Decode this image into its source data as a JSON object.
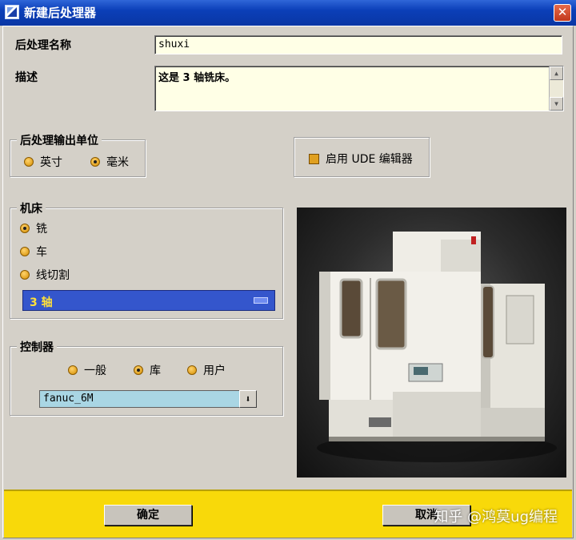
{
  "window": {
    "title": "新建后处理器",
    "close_glyph": "✕"
  },
  "fields": {
    "name_label": "后处理名称",
    "name_value": "shuxi",
    "desc_label": "描述",
    "desc_value": "这是 3 轴铣床。"
  },
  "units": {
    "title": "后处理输出单位",
    "options": [
      {
        "label": "英寸",
        "selected": false
      },
      {
        "label": "毫米",
        "selected": true
      }
    ]
  },
  "ude": {
    "label": "启用 UDE 编辑器",
    "checked": true
  },
  "machine": {
    "title": "机床",
    "options": [
      {
        "label": "铣",
        "selected": true
      },
      {
        "label": "车",
        "selected": false
      },
      {
        "label": "线切割",
        "selected": false
      }
    ],
    "axis_mode": "3 轴"
  },
  "controller": {
    "title": "控制器",
    "options": [
      {
        "label": "一般",
        "selected": false
      },
      {
        "label": "库",
        "selected": true
      },
      {
        "label": "用户",
        "selected": false
      }
    ],
    "value": "fanuc_6M",
    "dropdown_glyph": "⬇"
  },
  "buttons": {
    "ok": "确定",
    "cancel": "取消"
  },
  "watermark": "知乎 @鸿莫ug编程",
  "colors": {
    "accent": "#0a36a4",
    "footer": "#f8d90a",
    "field_bg": "#ffffe6",
    "selection": "#3456cc"
  }
}
